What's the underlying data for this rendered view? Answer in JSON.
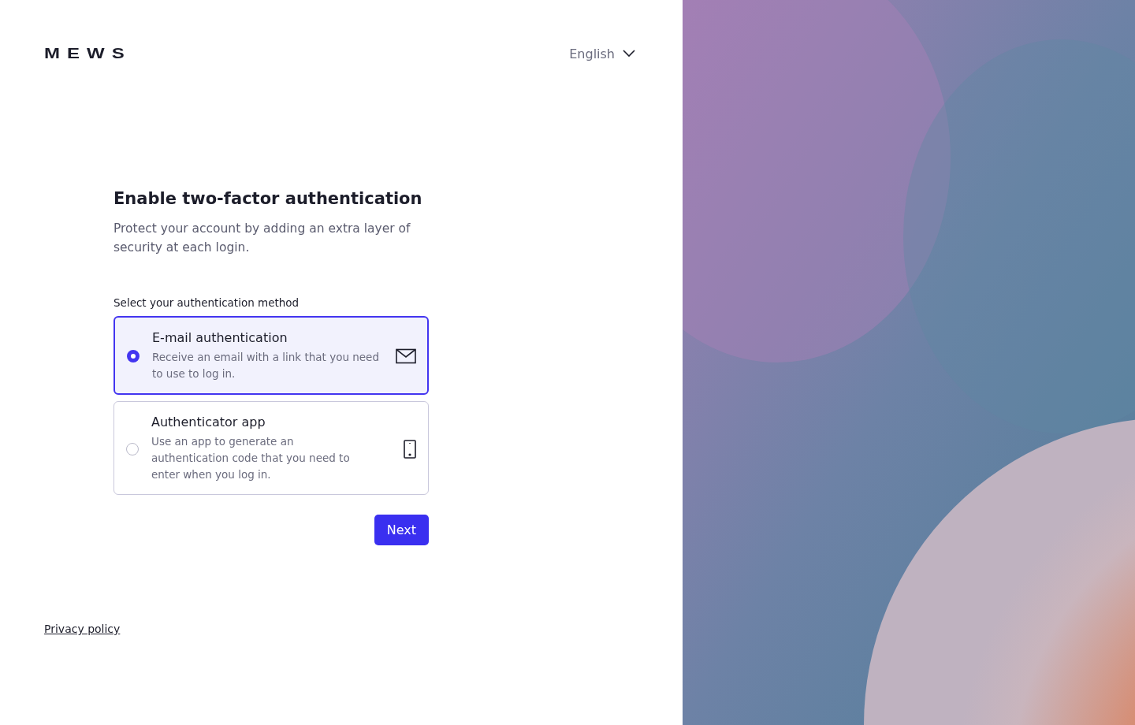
{
  "header": {
    "logo": "MEWS",
    "language": "English"
  },
  "form": {
    "title": "Enable two-factor authentication",
    "subtitle": "Protect your account by adding an extra layer of security at each login.",
    "method_label": "Select your authentication method",
    "options": [
      {
        "kind": "email",
        "title": "E-mail authentication",
        "description": "Receive an email with a link that you need to use to log in.",
        "selected": true
      },
      {
        "kind": "phone",
        "title": "Authenticator app",
        "description": "Use an app to generate an authentication code that you need to enter when you log in.",
        "selected": false
      }
    ],
    "next_button": "Next"
  },
  "footer": {
    "privacy_link": "Privacy policy"
  }
}
